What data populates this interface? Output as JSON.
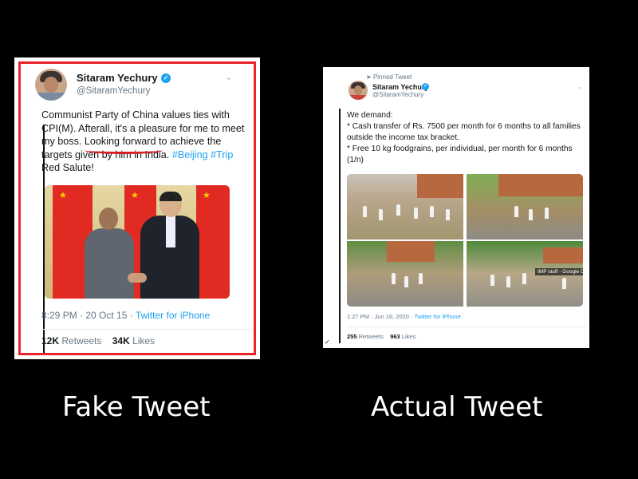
{
  "fake": {
    "caption": "Fake Tweet",
    "name": "Sitaram Yechury",
    "handle": "@SitaramYechury",
    "text_before_underline": "Communist Party of China values ties with CPI(M). Afterall, it's a pleasure for me to ",
    "underlined": "meet my boss",
    "text_after_underline": ". Looking forward to achieve the targets given by him in India. ",
    "hashtags": "#Beijing #Trip",
    "text_end": " Red Salute!",
    "time": "8:29 PM · 20 Oct 15 · ",
    "source": "Twitter for iPhone",
    "retweets_count": "12K",
    "retweets_label": "Retweets",
    "likes_count": "34K",
    "likes_label": "Likes",
    "frame_color": "#e8242c"
  },
  "actual": {
    "caption": "Actual Tweet",
    "pinned_label": "Pinned Tweet",
    "name": "Sitaram Yechury",
    "handle": "@SitaramYechury",
    "line1": "We demand:",
    "line2": "* Cash transfer of Rs. 7500 per month for 6 months to all families outside the income tax bracket.",
    "line3": "* Free 10 kg foodgrains, per individual, per month for 6 months (1/n)",
    "image_tag": "IMP stuff - Google Dr",
    "time": "1:27 PM · Jun 16, 2020 · ",
    "source": "Twitter for iPhone",
    "retweets_count": "255",
    "retweets_label": "Retweets",
    "likes_count": "963",
    "likes_label": "Likes"
  },
  "colors": {
    "link": "#1da1f2",
    "verified": "#1da1f2",
    "background": "#000000"
  },
  "icons": [
    "verified-badge-icon",
    "chevron-down-icon",
    "pin-icon"
  ]
}
